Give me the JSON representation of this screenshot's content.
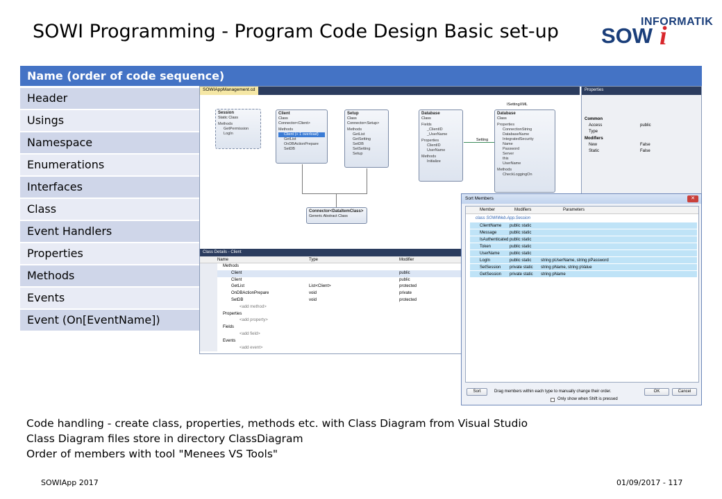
{
  "title": "SOWI Programming - Program Code Design Basic set-up",
  "logo": {
    "top": "INFORMATIK",
    "main": "SOW",
    "accent": "i"
  },
  "table": {
    "header": "Name (order of code sequence)",
    "rows": [
      "Header",
      "Usings",
      "Namespace",
      "Enumerations",
      "Interfaces",
      "Class",
      "Event Handlers",
      "Properties",
      "Methods",
      "Events",
      "Event  (On[EventName])"
    ]
  },
  "vs": {
    "tab": "SOWIAppManagement.cd",
    "iface": "ISettingXML",
    "setting_label": "Setting",
    "boxes": {
      "session": {
        "name": "Session",
        "kind": "Static Class",
        "sec": "Methods",
        "items": [
          "GetPermission",
          "LogIn"
        ]
      },
      "client": {
        "name": "Client",
        "kind": "Class",
        "base": "Connector<Client>",
        "sec": "Methods",
        "items": [
          "Client (+ 1 overload)",
          "GetList",
          "OnDBActionPrepare",
          "SetDB"
        ]
      },
      "setup": {
        "name": "Setup",
        "kind": "Class",
        "base": "Connector<Setup>",
        "sec": "Methods",
        "items": [
          "GetList",
          "GetSetting",
          "SetDB",
          "SetSetting",
          "Setup"
        ]
      },
      "database": {
        "name": "Database",
        "kind": "Class",
        "sec1": "Fields",
        "fields": [
          "_ClientID",
          "_UserName"
        ],
        "sec2": "Properties",
        "props": [
          "ClientID",
          "UserName"
        ],
        "sec3": "Methods",
        "methods": [
          "Initialize"
        ]
      },
      "setting": {
        "name": "Database",
        "kind": "Class",
        "sec": "Properties",
        "items": [
          "ConnectionString",
          "DatabaseName",
          "IntegratedSecurity",
          "Name",
          "Password",
          "Server",
          "this",
          "UserName"
        ],
        "sec2": "Methods",
        "methods": [
          "CheckLoggingOn"
        ]
      },
      "connector": {
        "name": "Connector<DataItemClass>",
        "kind": "Generic Abstract Class"
      }
    },
    "properties": {
      "title": "Properties",
      "cat1": "Common",
      "rows1": [
        [
          "Access",
          "public"
        ],
        [
          "Type",
          ""
        ]
      ],
      "cat2": "Modifiers",
      "rows2": [
        [
          "New",
          "False"
        ],
        [
          "Static",
          "False"
        ]
      ]
    },
    "details": {
      "title": "Class Details - Client",
      "cols": [
        "Name",
        "Type",
        "Modifier"
      ],
      "methods_label": "Methods",
      "rows": [
        [
          "Client",
          "",
          "public"
        ],
        [
          "Client",
          "",
          "public"
        ],
        [
          "GetList",
          "List<Client>",
          "protected"
        ],
        [
          "OnDBActionPrepare",
          "void",
          "private"
        ],
        [
          "SetDB",
          "void",
          "protected"
        ]
      ],
      "add_method": "<add method>",
      "props_label": "Properties",
      "add_property": "<add property>",
      "fields_label": "Fields",
      "add_field": "<add field>",
      "events_label": "Events",
      "add_event": "<add event>"
    },
    "sort": {
      "title": "Sort Members",
      "cols": [
        "Member",
        "Modifiers",
        "Parameters"
      ],
      "class_label": "class SOWIWeb.App.Session",
      "rows": [
        [
          "ClientName",
          "public static",
          ""
        ],
        [
          "Message",
          "public static",
          ""
        ],
        [
          "IsAuthenticated",
          "public static",
          ""
        ],
        [
          "Token",
          "public static",
          ""
        ],
        [
          "UserName",
          "public static",
          ""
        ],
        [
          "LogIn",
          "public static",
          "string pUserName, string pPassword"
        ],
        [
          "SetSession",
          "private static",
          "string pName, string pValue"
        ],
        [
          "GetSession",
          "private static",
          "string pName"
        ]
      ],
      "sort_btn": "Sort",
      "hint": "Drag members within each type to manually change their order.",
      "ok": "OK",
      "cancel": "Cancel",
      "checkbox_label": "Only show when Shift is pressed"
    }
  },
  "caption": [
    "Code handling - create class, properties, methods etc. with Class Diagram from Visual Studio",
    "Class Diagram files store in directory ClassDiagram",
    "Order of members with tool \"Menees VS Tools\""
  ],
  "footer": {
    "left": "SOWIApp 2017",
    "right": "01/09/2017 - 117"
  },
  "colors": {
    "table_header": "#4473c5",
    "row_dark": "#cfd6e9",
    "row_light": "#e8ebf5",
    "vs_dark": "#2b3c5e",
    "logo_blue": "#1a3e7a",
    "logo_red": "#d8262b"
  }
}
